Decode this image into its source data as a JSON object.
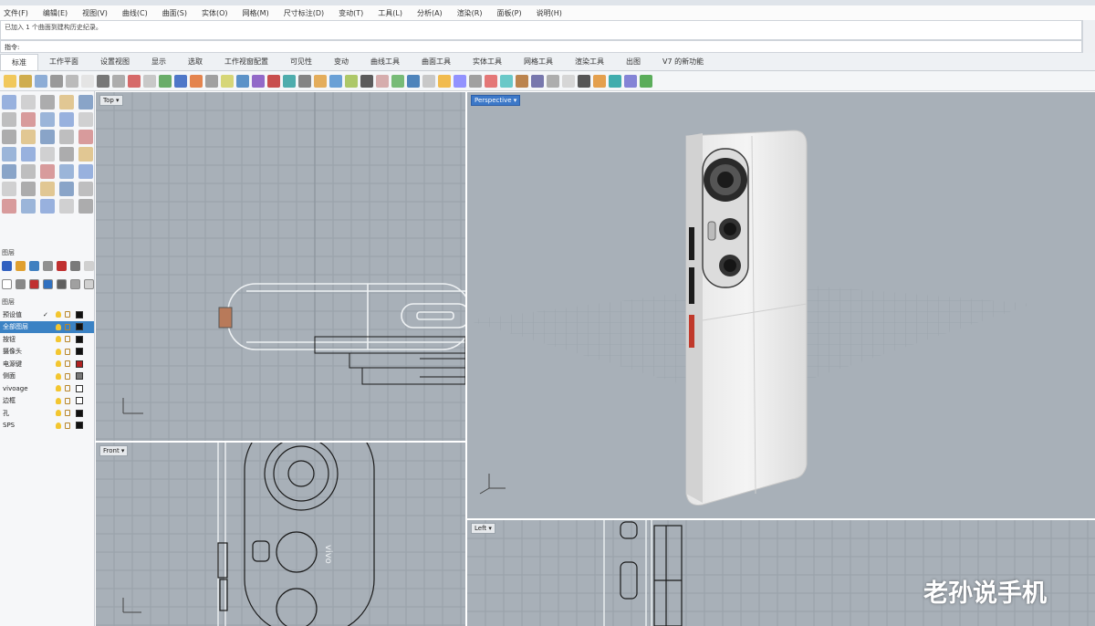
{
  "menu": [
    "文件(F)",
    "编辑(E)",
    "视图(V)",
    "曲线(C)",
    "曲面(S)",
    "实体(O)",
    "网格(M)",
    "尺寸标注(D)",
    "变动(T)",
    "工具(L)",
    "分析(A)",
    "渲染(R)",
    "面板(P)",
    "说明(H)"
  ],
  "command": {
    "history": "已加入 1 个曲面到建构历史纪录。",
    "prompt": "指令:"
  },
  "tabs": [
    "标准",
    "工作平面",
    "设置视图",
    "显示",
    "选取",
    "工作视窗配置",
    "可见性",
    "变动",
    "曲线工具",
    "曲面工具",
    "实体工具",
    "网格工具",
    "渲染工具",
    "出图",
    "V7 的新功能"
  ],
  "active_tab_index": 0,
  "left_panel": {
    "section_label": "图层",
    "layers_header": "图层",
    "layers": [
      {
        "name": "预设值",
        "check": "✓",
        "swatch": "#111111"
      },
      {
        "name": "全部图层",
        "check": "",
        "swatch": "#111111",
        "selected": true
      },
      {
        "name": "按钮",
        "check": "",
        "swatch": "#111111"
      },
      {
        "name": "摄像头",
        "check": "",
        "swatch": "#111111"
      },
      {
        "name": "电源键",
        "check": "",
        "swatch": "#b02020"
      },
      {
        "name": "侧面",
        "check": "",
        "swatch": "#777777"
      },
      {
        "name": "vivoage",
        "check": "",
        "swatch": "#ffffff"
      },
      {
        "name": "边框",
        "check": "",
        "swatch": "#ffffff"
      },
      {
        "name": "孔",
        "check": "",
        "swatch": "#111111"
      },
      {
        "name": "SPS",
        "check": "",
        "swatch": "#111111"
      }
    ]
  },
  "viewports": {
    "top": {
      "label": "Top ▾"
    },
    "perspective": {
      "label": "Perspective ▾"
    },
    "front": {
      "label": "Front ▾"
    },
    "left": {
      "label": "Left ▾"
    },
    "model_text": "vivo"
  },
  "watermark": "老孙说手机",
  "colors": {
    "viewport_bg": "#a8b0b8",
    "grid_line": "#98a1a9",
    "active_label": "#3c78c8",
    "selection": "#3b82c4"
  }
}
